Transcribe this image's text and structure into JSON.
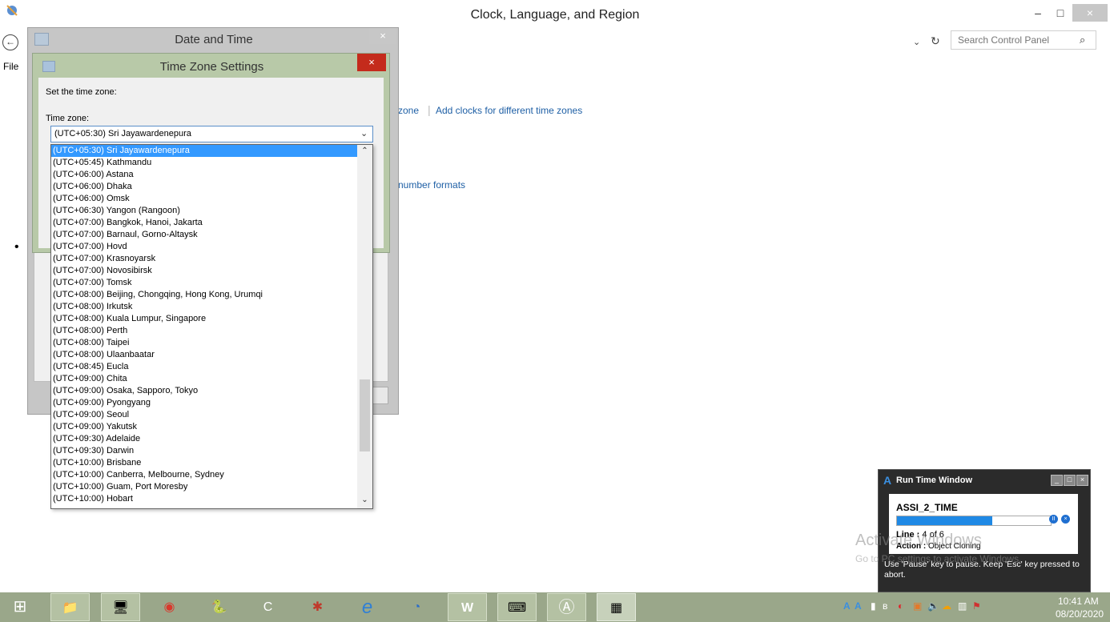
{
  "window": {
    "title": "Clock, Language, and Region",
    "minimize": "–",
    "maximize": "□",
    "close": "×",
    "back": "←",
    "address_dropdown": "⌄",
    "refresh": "↻",
    "search_placeholder": "Search Control Panel",
    "search_icon": "⌕",
    "menu_file": "File"
  },
  "content": {
    "link_time_zone": "zone",
    "link_separator": "|",
    "link_add_clocks": "Add clocks for different time zones",
    "link_number_formats": "number formats",
    "bullet": "•"
  },
  "date_time_dialog": {
    "title": "Date and Time",
    "close": "×"
  },
  "tz_dialog": {
    "title": "Time Zone Settings",
    "close": "×",
    "set_label": "Set the time zone:",
    "zone_label": "Time zone:",
    "selected": "(UTC+05:30) Sri Jayawardenepura",
    "combo_arrow": "⌄",
    "scroll_up": "⌃",
    "scroll_down": "⌄",
    "options": [
      "(UTC+05:30) Sri Jayawardenepura",
      "(UTC+05:45) Kathmandu",
      "(UTC+06:00) Astana",
      "(UTC+06:00) Dhaka",
      "(UTC+06:00) Omsk",
      "(UTC+06:30) Yangon (Rangoon)",
      "(UTC+07:00) Bangkok, Hanoi, Jakarta",
      "(UTC+07:00) Barnaul, Gorno-Altaysk",
      "(UTC+07:00) Hovd",
      "(UTC+07:00) Krasnoyarsk",
      "(UTC+07:00) Novosibirsk",
      "(UTC+07:00) Tomsk",
      "(UTC+08:00) Beijing, Chongqing, Hong Kong, Urumqi",
      "(UTC+08:00) Irkutsk",
      "(UTC+08:00) Kuala Lumpur, Singapore",
      "(UTC+08:00) Perth",
      "(UTC+08:00) Taipei",
      "(UTC+08:00) Ulaanbaatar",
      "(UTC+08:45) Eucla",
      "(UTC+09:00) Chita",
      "(UTC+09:00) Osaka, Sapporo, Tokyo",
      "(UTC+09:00) Pyongyang",
      "(UTC+09:00) Seoul",
      "(UTC+09:00) Yakutsk",
      "(UTC+09:30) Adelaide",
      "(UTC+09:30) Darwin",
      "(UTC+10:00) Brisbane",
      "(UTC+10:00) Canberra, Melbourne, Sydney",
      "(UTC+10:00) Guam, Port Moresby",
      "(UTC+10:00) Hobart"
    ]
  },
  "runtime_window": {
    "icon": "A",
    "title": "Run Time Window",
    "min": "_",
    "max": "□",
    "close": "×",
    "script_name": "ASSI_2_TIME",
    "progress": 0.62,
    "pause_glyph": "II",
    "stop_glyph": "×",
    "line_label": "Line :",
    "line_value": "4 of 6",
    "action_label": "Action :",
    "action_value": "Object Cloning",
    "hint": "Use 'Pause' key to pause. Keep 'Esc' key pressed to abort."
  },
  "watermark": {
    "line1": "Activate Windows",
    "line2": "Go to PC settings to activate Windows."
  },
  "taskbar": {
    "start_icon": "⊞",
    "icons": {
      "explorer": "📁",
      "rdp": "🖥",
      "chrome": "◉",
      "python": "🐍",
      "capp": "C",
      "spider": "✱",
      "ie": "e",
      "appx": "◔",
      "word": "W",
      "region": "⌨",
      "anchor": "Ⓐ",
      "datetime": "▦"
    },
    "tray": {
      "a1": "A",
      "a2": "A",
      "signal": "▮",
      "bluetooth": "ʙ",
      "app1": "◐",
      "app2": "▣",
      "volume": "🔈",
      "cloud": "☁",
      "network": "▥",
      "flag": "⚑"
    },
    "time": "10:41 AM",
    "date": "08/20/2020"
  },
  "colors": {
    "selection": "#3399ff",
    "link": "#1e5fa5",
    "tz_frame": "#b8c9a8",
    "close_red": "#c42b1c",
    "taskbar": "#9aa78a",
    "progress": "#1f89e5"
  }
}
